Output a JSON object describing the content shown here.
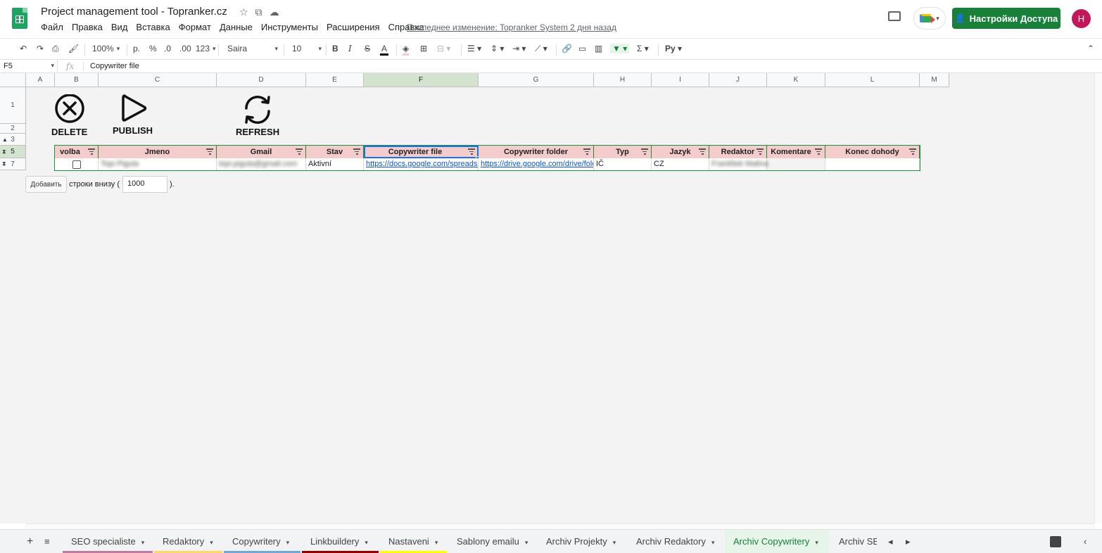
{
  "header": {
    "title": "Project management tool - Topranker.cz",
    "menu": [
      "Файл",
      "Правка",
      "Вид",
      "Вставка",
      "Формат",
      "Данные",
      "Инструменты",
      "Расширения",
      "Справка"
    ],
    "last_edit": "Последнее изменение: Topranker System 2 дня назад",
    "share_label": "Настройки Доступа",
    "avatar_letter": "H",
    "accent": "#188038"
  },
  "toolbar": {
    "zoom": "100%",
    "currency": "р.",
    "percent": "%",
    "dec_decrease": ".0",
    "dec_increase": ".00",
    "format_more": "123",
    "font": "Saira",
    "font_size": "10",
    "bold": "B",
    "italic": "I",
    "strike": "S",
    "text_color": "A",
    "sum": "Σ",
    "input_tools": "Pу"
  },
  "formula_bar": {
    "cell_ref": "F5",
    "fx": "fx",
    "value": "Copywriter file"
  },
  "columns": [
    "A",
    "B",
    "C",
    "D",
    "E",
    "F",
    "G",
    "H",
    "I",
    "J",
    "K",
    "L",
    "M"
  ],
  "rows": [
    "1",
    "2",
    "3",
    "5",
    "7"
  ],
  "actions": {
    "delete": "DELETE",
    "publish": "PUBLISH",
    "refresh": "REFRESH"
  },
  "table": {
    "headers": [
      "volba",
      "Jmeno",
      "Gmail",
      "Stav",
      "Copywriter file",
      "Copywriter folder",
      "Typ",
      "Jazyk",
      "Redaktor",
      "Komentare",
      "Konec dohody"
    ],
    "row": {
      "jmeno": "Topi Pigula",
      "gmail": "topi.pigula@gmail.com",
      "stav": "Aktivní",
      "file": "https://docs.google.com/spreadsheets",
      "folder": "https://drive.google.com/drive/folders",
      "typ": "IČ",
      "jazyk": "CZ",
      "redaktor": "František Malina",
      "komentare": "",
      "konec": ""
    }
  },
  "add_rows": {
    "button": "Добавить",
    "text": "строки внизу (",
    "value": "1000",
    "tail": ")."
  },
  "sheet_tabs": [
    {
      "name": "SEO specialiste",
      "color": "#c27ba0"
    },
    {
      "name": "Redaktory",
      "color": "#ffd966"
    },
    {
      "name": "Copywritery",
      "color": "#6fa8dc"
    },
    {
      "name": "Linkbuildery",
      "color": "#990000"
    },
    {
      "name": "Nastaveni",
      "color": "#ffff00"
    },
    {
      "name": "Sablony emailu",
      "color": ""
    },
    {
      "name": "Archiv Projekty",
      "color": ""
    },
    {
      "name": "Archiv Redaktory",
      "color": ""
    },
    {
      "name": "Archiv Copywritery",
      "color": ""
    },
    {
      "name": "Archiv SE",
      "color": ""
    }
  ]
}
